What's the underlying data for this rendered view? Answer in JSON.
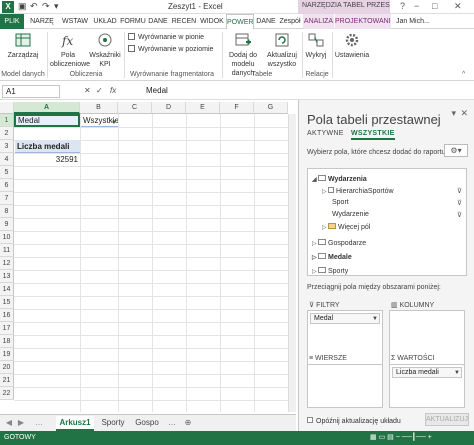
{
  "window": {
    "title": "Zeszyt1 - Excel",
    "context_title": "NARZĘDZIA TABEL PRZESTA...",
    "buttons": [
      "?",
      "−",
      "□",
      "✕"
    ]
  },
  "ribbon_tabs": [
    {
      "label": "PLIK"
    },
    {
      "label": "NARZĘ"
    },
    {
      "label": "WSTAW"
    },
    {
      "label": "UKŁAD"
    },
    {
      "label": "FORMU"
    },
    {
      "label": "DANE"
    },
    {
      "label": "RECEN"
    },
    {
      "label": "WIDOK"
    },
    {
      "label": "POWER"
    },
    {
      "label": "DANE"
    },
    {
      "label": "Zespół"
    },
    {
      "label": "ANALIZA"
    },
    {
      "label": "PROJEKTOWANIE"
    }
  ],
  "user": {
    "name": "Jan Mich..."
  },
  "ribbon": {
    "zarzadzaj": "Zarządzaj",
    "model_danych": "Model danych",
    "pola_obliczeniowe": "Pola obliczeniowe",
    "wskazniki_kpi": "Wskaźniki KPI",
    "obliczenia": "Obliczenia",
    "wyr_pionie": "Wyrównanie w pionie",
    "wyr_poziomie": "Wyrównanie w poziomie",
    "wyr_frag": "Wyrównanie fragmentatora",
    "dodaj_model": "Dodaj do modelu danych",
    "aktualizuj": "Aktualizuj wszystko",
    "tabele": "Tabele",
    "wykryj": "Wykryj",
    "relacje": "Relacje",
    "ustawienia": "Ustawienia"
  },
  "formula_bar": {
    "name_box": "A1",
    "cancel": "✕",
    "enter": "✓",
    "fx": "fx",
    "value": "Medal"
  },
  "sheet": {
    "columns": [
      "A",
      "B",
      "C",
      "D",
      "E",
      "F",
      "G"
    ],
    "rows": [
      "1",
      "2",
      "3",
      "4",
      "5",
      "6",
      "7",
      "8",
      "9",
      "10",
      "11",
      "12",
      "13",
      "14",
      "15",
      "16",
      "17",
      "18",
      "19",
      "20",
      "21",
      "22"
    ],
    "cells": {
      "A1": "Medal",
      "B1": "Wszystkie",
      "A3": "Liczba medali",
      "A4": "32591"
    }
  },
  "sheet_tabs": [
    "Arkusz1",
    "Sporty",
    "Gospo"
  ],
  "status": {
    "text": "GOTOWY"
  },
  "pivot_pane": {
    "title": "Pola tabeli przestawnej",
    "tabs": [
      "AKTYWNE",
      "WSZYSTKIE"
    ],
    "hint": "Wybierz pola, które chcesz dodać do raportu:",
    "fields": [
      {
        "label": "Wydarzenia"
      },
      {
        "label": "HierarchiaSportów"
      },
      {
        "label": "Sport"
      },
      {
        "label": "Wydarzenie"
      },
      {
        "label": "Więcej pól"
      },
      {
        "label": "Gospodarze"
      },
      {
        "label": "Medale"
      },
      {
        "label": "Sporty"
      }
    ],
    "drag_hint": "Przeciągnij pola między obszarami poniżej:",
    "zones": {
      "filtry": {
        "label": "FILTRY",
        "items": [
          "Medal"
        ]
      },
      "kolumny": {
        "label": "KOLUMNY",
        "items": []
      },
      "wiersze": {
        "label": "WIERSZE",
        "items": []
      },
      "wartosci": {
        "label": "WARTOŚCI",
        "items": [
          "Liczba medali"
        ]
      }
    },
    "defer_label": "Opóźnij aktualizację układu",
    "update_button": "AKTUALIZUJ"
  }
}
